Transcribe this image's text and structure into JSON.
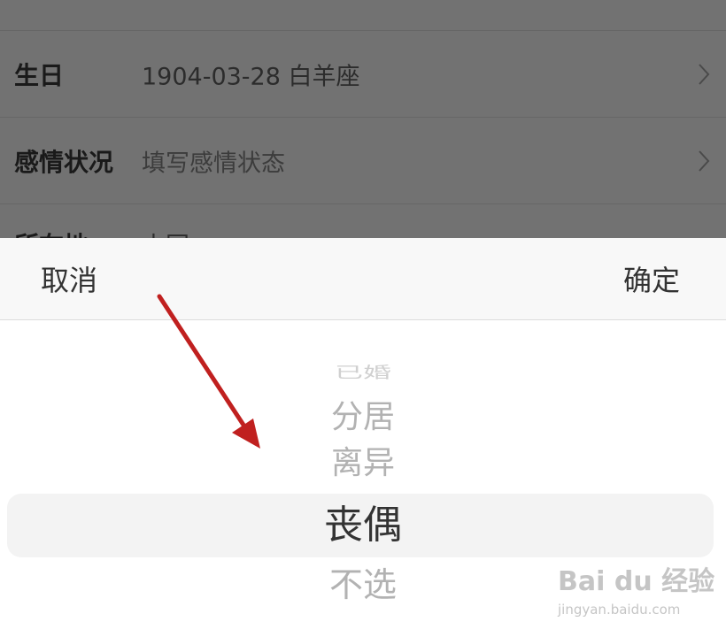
{
  "background_form": {
    "rows": [
      {
        "label": "生日",
        "value": "1904-03-28 白羊座"
      },
      {
        "label": "感情状况",
        "value": "填写感情状态"
      }
    ],
    "partial_row": {
      "label": "所在地",
      "value": "中国"
    }
  },
  "toolbar": {
    "cancel_label": "取消",
    "confirm_label": "确定"
  },
  "picker": {
    "options": [
      "已婚",
      "分居",
      "离异",
      "丧偶",
      "不选"
    ],
    "selected": "丧偶"
  },
  "watermark": {
    "brand": "Bai du 经验",
    "url": "jingyan.baidu.com"
  },
  "colors": {
    "overlay_background": "#727272",
    "toolbar_background": "#f8f8f8",
    "selected_highlight": "#f3f3f3",
    "annotation_arrow": "#c0201f"
  }
}
